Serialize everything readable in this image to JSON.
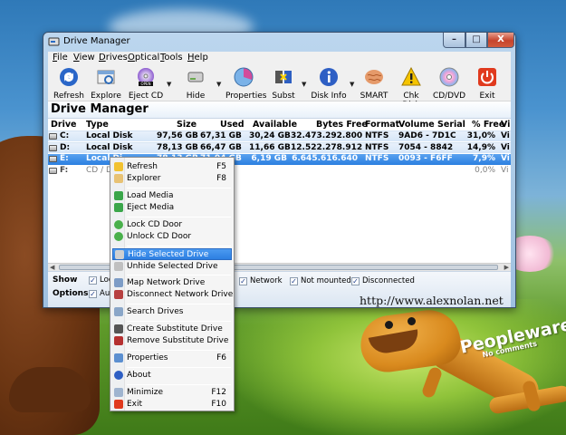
{
  "window": {
    "title": "Drive Manager",
    "controls": {
      "minimize": "–",
      "maximize": "□",
      "close": "X"
    }
  },
  "menubar": [
    {
      "mnemonic": "F",
      "rest": "ile"
    },
    {
      "mnemonic": "V",
      "rest": "iew"
    },
    {
      "mnemonic": "D",
      "rest": "rives"
    },
    {
      "mnemonic": "O",
      "rest": "ptical"
    },
    {
      "mnemonic": "T",
      "rest": "ools"
    },
    {
      "mnemonic": "H",
      "rest": "elp"
    }
  ],
  "toolbar": {
    "refresh": "Refresh",
    "explore": "Explore",
    "eject_cd": "Eject CD",
    "eject_badge": "OPEN",
    "hide": "Hide",
    "properties": "Properties",
    "subst": "Subst",
    "disk_info": "Disk Info",
    "smart": "SMART",
    "chk_disk": "Chk Disk",
    "cd_dvd": "CD/DVD",
    "exit": "Exit"
  },
  "header_title": "Drive Manager",
  "columns": [
    "Drive",
    "Type",
    "Size",
    "Used",
    "Available",
    "Bytes Free",
    "Format",
    "Volume Serial",
    "% Free",
    "Vi"
  ],
  "drives": [
    {
      "drive": "C:",
      "type": "Local Disk",
      "size": "97,56 GB",
      "used": "67,31 GB",
      "available": "30,24 GB",
      "bytes_free": "32.473.292.800",
      "format": "NTFS",
      "serial": "9AD6 - 7D1C",
      "pct_free": "31,0%",
      "vi": "Vi"
    },
    {
      "drive": "D:",
      "type": "Local Disk",
      "size": "78,13 GB",
      "used": "66,47 GB",
      "available": "11,66 GB",
      "bytes_free": "12.522.278.912",
      "format": "NTFS",
      "serial": "7054 - 8842",
      "pct_free": "14,9%",
      "vi": "Vi"
    },
    {
      "drive": "E:",
      "type": "Local Di",
      "size": "78,13 GB",
      "used": "71,94 GB",
      "available": "6,19 GB",
      "bytes_free": "6.645.616.640",
      "format": "NTFS",
      "serial": "0093 - F6FF",
      "pct_free": "7,9%",
      "vi": "Vi"
    },
    {
      "drive": "F:",
      "type": "CD / D",
      "size": "",
      "used": "",
      "available": "",
      "bytes_free": "",
      "format": "",
      "serial": "",
      "pct_free": "0,0%",
      "vi": "Vi"
    }
  ],
  "options": {
    "show_label": "Show",
    "options_label": "Options",
    "show_local": "Loc",
    "show_network": "Network",
    "show_not_mounted": "Not mounted",
    "show_disconnected": "Disconnected",
    "auto": "Auto",
    "url": "http://www.alexnolan.net"
  },
  "context_menu": {
    "refresh": {
      "label": "Refresh",
      "shortcut": "F5"
    },
    "explorer": {
      "label": "Explorer",
      "shortcut": "F8"
    },
    "load_media": {
      "label": "Load Media"
    },
    "eject_media": {
      "label": "Eject Media"
    },
    "lock_cd": {
      "label": "Lock CD Door"
    },
    "unlock_cd": {
      "label": "Unlock CD Door"
    },
    "hide_drive": {
      "label": "Hide Selected Drive"
    },
    "unhide_drive": {
      "label": "Unhide Selected Drive"
    },
    "map_drive": {
      "label": "Map Network Drive"
    },
    "disconnect_drive": {
      "label": "Disconnect Network Drive"
    },
    "search_drives": {
      "label": "Search Drives"
    },
    "create_subst": {
      "label": "Create Substitute Drive"
    },
    "remove_subst": {
      "label": "Remove Substitute Drive"
    },
    "properties": {
      "label": "Properties",
      "shortcut": "F6"
    },
    "about": {
      "label": "About"
    },
    "minimize": {
      "label": "Minimize",
      "shortcut": "F12"
    },
    "exit": {
      "label": "Exit",
      "shortcut": "F10"
    }
  },
  "wallpaper": {
    "logo": "Peopleware",
    "logo_sub": "No comments"
  },
  "colors": {
    "selection": "#2d7fe2",
    "row_highlight": "#d6e6f7",
    "accent": "#3a4f6a"
  }
}
